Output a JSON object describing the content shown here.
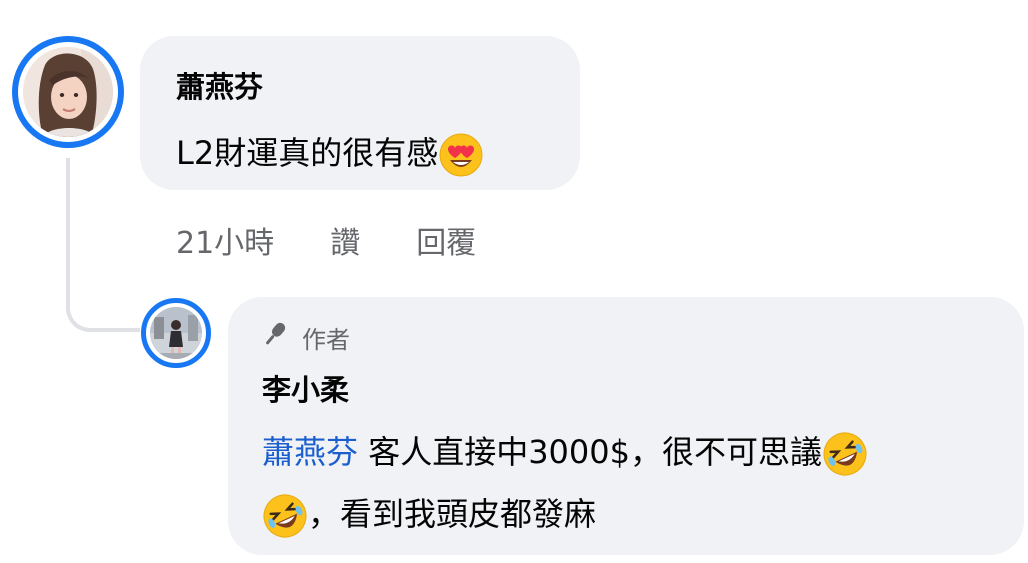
{
  "colors": {
    "accent_ring": "#1877F2",
    "bubble_bg": "#f0f2f5",
    "mention_link": "#1b5fcf",
    "meta_text": "#65676b",
    "thread_line": "#dfe1e5"
  },
  "comment": {
    "author_name": "蕭燕芬",
    "text": "L2財運真的很有感",
    "emoji": "heart-eyes-emoji",
    "time": "21小時",
    "like_label": "讚",
    "reply_label": "回覆"
  },
  "reply": {
    "badge_icon": "microphone-icon",
    "badge_label": "作者",
    "author_name": "李小柔",
    "mention": "蕭燕芬",
    "text_line1": "客人直接中3000$，很不可思議",
    "text_line2": "，看到我頭皮都發麻",
    "emoji": "rolling-laughing-emoji"
  }
}
